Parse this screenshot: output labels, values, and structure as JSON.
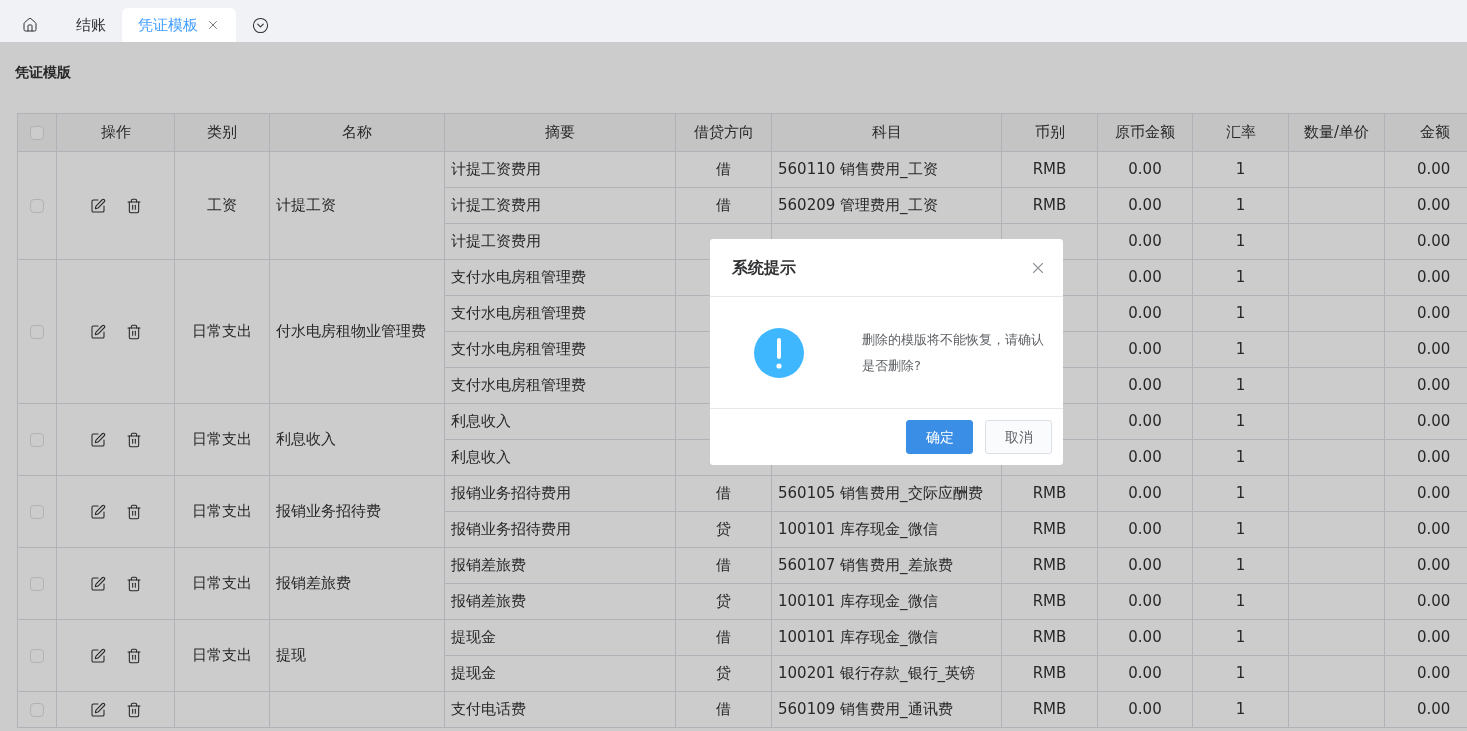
{
  "tabs": [
    {
      "kind": "home",
      "selected": false
    },
    {
      "kind": "text",
      "label": "结账",
      "selected": false,
      "closable": false
    },
    {
      "kind": "text",
      "label": "凭证模板",
      "selected": true,
      "closable": true
    },
    {
      "kind": "more",
      "selected": false
    }
  ],
  "page_title": "凭证模版",
  "table": {
    "columns": [
      "操作",
      "类别",
      "名称",
      "摘要",
      "借贷方向",
      "科目",
      "币别",
      "原币金额",
      "汇率",
      "数量/单价",
      "金额"
    ],
    "header_checked": false,
    "groups": [
      {
        "checked": false,
        "category": "工资",
        "name": "计提工资",
        "lines": [
          {
            "summary": "计提工资费用",
            "direction": "借",
            "account": "560110 销售费用_工资",
            "currency": "RMB",
            "amount": "0.00",
            "rate": "1",
            "total": "0.00"
          },
          {
            "summary": "计提工资费用",
            "direction": "借",
            "account": "560209 管理费用_工资",
            "currency": "RMB",
            "amount": "0.00",
            "rate": "1",
            "total": "0.00"
          },
          {
            "summary": "计提工资费用",
            "amount": "0.00",
            "rate": "1",
            "total": "0.00"
          }
        ]
      },
      {
        "checked": false,
        "category": "日常支出",
        "name": "付水电房租物业管理费",
        "lines": [
          {
            "summary": "支付水电房租管理费",
            "amount": "0.00",
            "rate": "1",
            "total": "0.00"
          },
          {
            "summary": "支付水电房租管理费",
            "amount": "0.00",
            "rate": "1",
            "total": "0.00"
          },
          {
            "summary": "支付水电房租管理费",
            "amount": "0.00",
            "rate": "1",
            "total": "0.00"
          },
          {
            "summary": "支付水电房租管理费",
            "amount": "0.00",
            "rate": "1",
            "total": "0.00"
          }
        ]
      },
      {
        "checked": false,
        "category": "日常支出",
        "name": "利息收入",
        "lines": [
          {
            "summary": "利息收入",
            "amount": "0.00",
            "rate": "1",
            "total": "0.00"
          },
          {
            "summary": "利息收入",
            "amount": "0.00",
            "rate": "1",
            "total": "0.00"
          }
        ]
      },
      {
        "checked": false,
        "category": "日常支出",
        "name": "报销业务招待费",
        "lines": [
          {
            "summary": "报销业务招待费用",
            "direction": "借",
            "account": "560105 销售费用_交际应酬费",
            "currency": "RMB",
            "amount": "0.00",
            "rate": "1",
            "total": "0.00"
          },
          {
            "summary": "报销业务招待费用",
            "direction": "贷",
            "account": "100101 库存现金_微信",
            "currency": "RMB",
            "amount": "0.00",
            "rate": "1",
            "total": "0.00"
          }
        ]
      },
      {
        "checked": false,
        "category": "日常支出",
        "name": "报销差旅费",
        "lines": [
          {
            "summary": "报销差旅费",
            "direction": "借",
            "account": "560107 销售费用_差旅费",
            "currency": "RMB",
            "amount": "0.00",
            "rate": "1",
            "total": "0.00"
          },
          {
            "summary": "报销差旅费",
            "direction": "贷",
            "account": "100101 库存现金_微信",
            "currency": "RMB",
            "amount": "0.00",
            "rate": "1",
            "total": "0.00"
          }
        ]
      },
      {
        "checked": false,
        "category": "日常支出",
        "name": "提现",
        "lines": [
          {
            "summary": "提现金",
            "direction": "借",
            "account": "100101 库存现金_微信",
            "currency": "RMB",
            "amount": "0.00",
            "rate": "1",
            "total": "0.00"
          },
          {
            "summary": "提现金",
            "direction": "贷",
            "account": "100201 银行存款_银行_英镑",
            "currency": "RMB",
            "amount": "0.00",
            "rate": "1",
            "total": "0.00"
          }
        ]
      },
      {
        "checked": false,
        "lines": [
          {
            "summary": "支付电话费",
            "direction": "借",
            "account": "560109 销售费用_通讯费",
            "currency": "RMB",
            "amount": "0.00",
            "rate": "1",
            "total": "0.00"
          }
        ]
      }
    ]
  },
  "dialog": {
    "title": "系统提示",
    "message": "删除的模版将不能恢复，请确认是否删除?",
    "buttons": [
      {
        "label": "确定",
        "kind": "primary"
      },
      {
        "label": "取消",
        "kind": "default"
      }
    ]
  }
}
